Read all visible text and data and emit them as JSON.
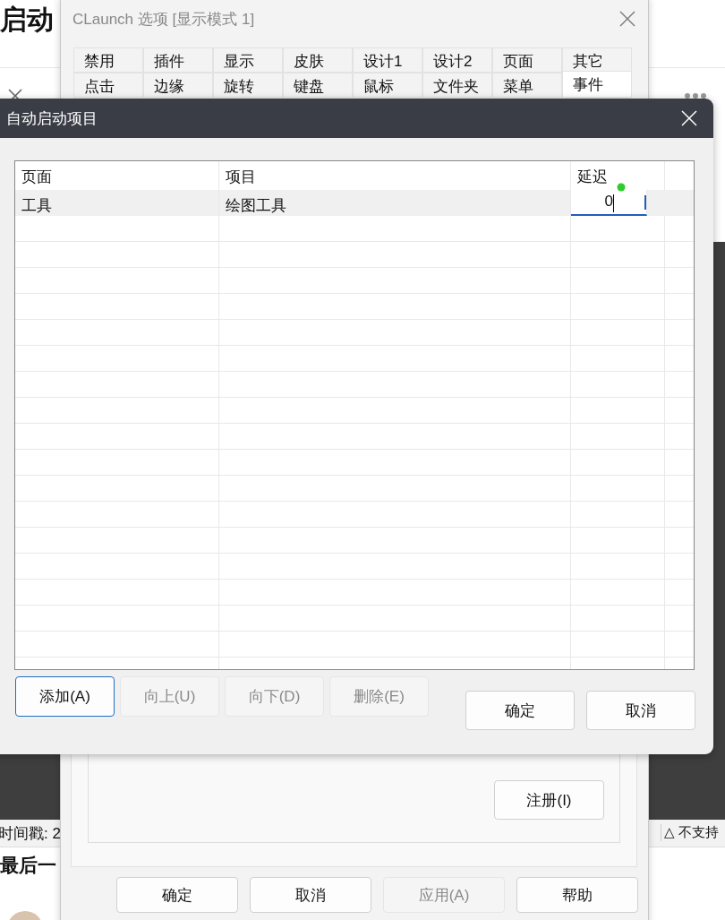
{
  "background_page": {
    "heading": "启动",
    "subheading": "最后一",
    "status_left": "时间戳: 2",
    "status_right_mark": "△",
    "status_right": "不支持"
  },
  "options_window": {
    "title": "CLaunch 选项 [显示模式 1]",
    "tab_rows": [
      [
        {
          "label": "禁用",
          "selected": false
        },
        {
          "label": "插件",
          "selected": false
        },
        {
          "label": "显示",
          "selected": false
        },
        {
          "label": "皮肤",
          "selected": false
        },
        {
          "label": "设计1",
          "selected": false
        },
        {
          "label": "设计2",
          "selected": false
        },
        {
          "label": "页面",
          "selected": false
        },
        {
          "label": "其它",
          "selected": false
        }
      ],
      [
        {
          "label": "点击",
          "selected": false
        },
        {
          "label": "边缘",
          "selected": false
        },
        {
          "label": "旋转",
          "selected": false
        },
        {
          "label": "键盘",
          "selected": false
        },
        {
          "label": "鼠标",
          "selected": false
        },
        {
          "label": "文件夹",
          "selected": false
        },
        {
          "label": "菜单",
          "selected": false
        },
        {
          "label": "事件",
          "selected": true
        }
      ]
    ],
    "register_button": "注册(I)",
    "buttons": [
      {
        "label": "确定",
        "disabled": false
      },
      {
        "label": "取消",
        "disabled": false
      },
      {
        "label": "应用(A)",
        "disabled": true
      },
      {
        "label": "帮助",
        "disabled": false
      }
    ]
  },
  "dialog": {
    "title": "自动启动项目",
    "columns": [
      "页面",
      "项目",
      "延迟"
    ],
    "rows": [
      {
        "page": "工具",
        "item": "绘图工具",
        "delay": "0",
        "editing": true
      }
    ],
    "list_buttons": [
      {
        "label": "添加(A)",
        "disabled": false,
        "focused": true
      },
      {
        "label": "向上(U)",
        "disabled": true,
        "focused": false
      },
      {
        "label": "向下(D)",
        "disabled": true,
        "focused": false
      },
      {
        "label": "删除(E)",
        "disabled": true,
        "focused": false
      }
    ],
    "buttons": [
      {
        "label": "确定",
        "disabled": false
      },
      {
        "label": "取消",
        "disabled": false
      }
    ]
  }
}
